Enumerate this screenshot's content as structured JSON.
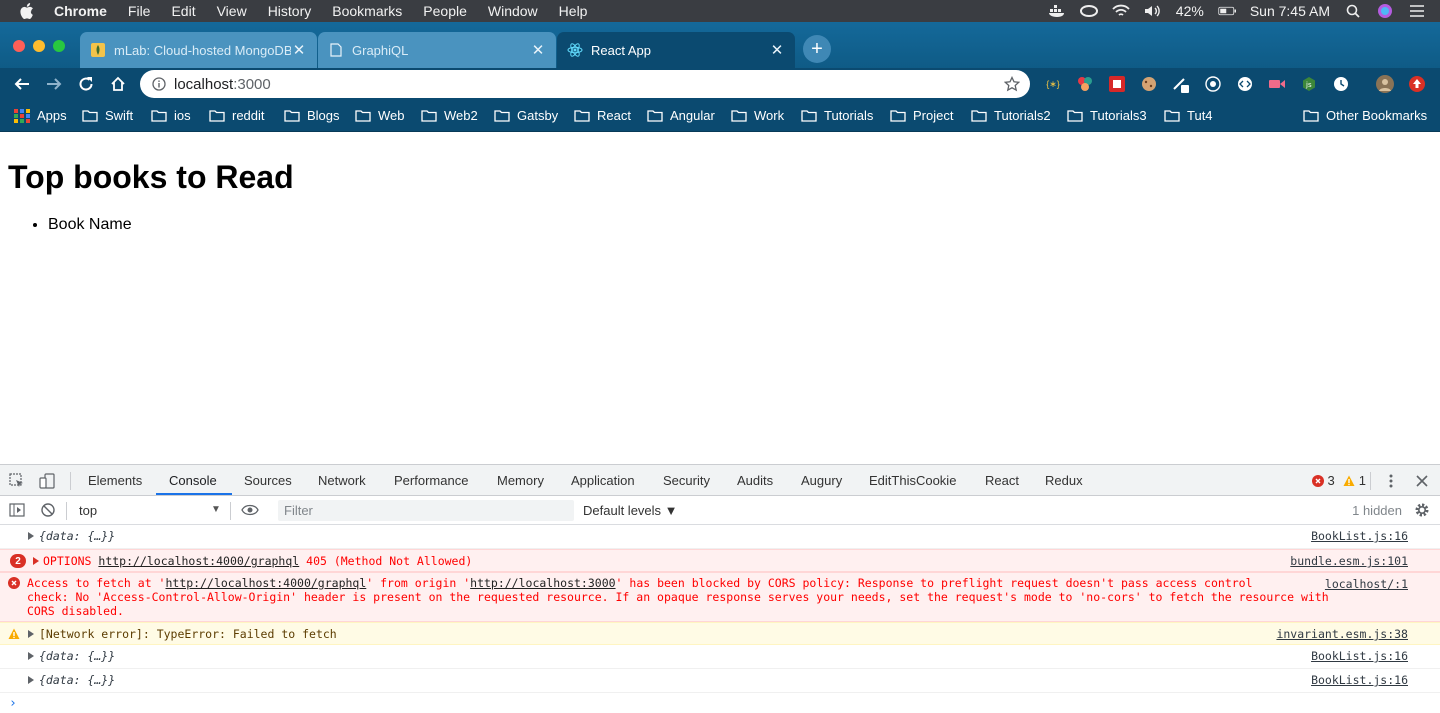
{
  "menubar": {
    "app": "Chrome",
    "items": [
      "File",
      "Edit",
      "View",
      "History",
      "Bookmarks",
      "People",
      "Window",
      "Help"
    ],
    "battery": "42%",
    "clock": "Sun 7:45 AM"
  },
  "tabs": [
    {
      "label": "mLab: Cloud-hosted MongoDB",
      "icon": "mlab-icon",
      "active": false
    },
    {
      "label": "GraphiQL",
      "icon": "page-icon",
      "active": false
    },
    {
      "label": "React App",
      "icon": "react-icon",
      "active": true
    }
  ],
  "toolbar": {
    "url_host": "localhost",
    "url_port": ":3000"
  },
  "bookmarks": {
    "apps": "Apps",
    "folders": [
      "Swift",
      "ios",
      "reddit",
      "Blogs",
      "Web",
      "Web2",
      "Gatsby",
      "React",
      "Angular",
      "Work",
      "Tutorials",
      "Project",
      "Tutorials2",
      "Tutorials3",
      "Tut4"
    ],
    "other": "Other Bookmarks"
  },
  "page": {
    "title": "Top books to Read",
    "items": [
      "Book Name"
    ]
  },
  "devtools": {
    "tabs": [
      "Elements",
      "Console",
      "Sources",
      "Network",
      "Performance",
      "Memory",
      "Application",
      "Security",
      "Audits",
      "Augury",
      "EditThisCookie",
      "React",
      "Redux"
    ],
    "active_tab": "Console",
    "error_count": "3",
    "warning_count": "1",
    "context": "top",
    "filter_placeholder": "Filter",
    "levels": "Default levels ▼",
    "hidden": "1 hidden",
    "messages": [
      {
        "type": "log",
        "text": "{data: {…}}",
        "source": "BookList.js:16"
      },
      {
        "type": "error",
        "count": "2",
        "method": "OPTIONS",
        "url": "http://localhost:4000/graphql",
        "status": "405 (Method Not Allowed)",
        "source": "bundle.esm.js:101"
      },
      {
        "type": "error",
        "text_pre": "Access to fetch at '",
        "url1": "http://localhost:4000/graphql",
        "text_mid": "' from origin '",
        "url2": "http://localhost:3000",
        "text_post": "' has been blocked by CORS policy: Response to preflight request doesn't pass access control",
        "line2": "check: No 'Access-Control-Allow-Origin' header is present on the requested resource. If an opaque response serves your needs, set the request's mode to 'no-cors' to fetch the resource with",
        "line3": "CORS disabled.",
        "source": "localhost/:1"
      },
      {
        "type": "warning",
        "text": "[Network error]: TypeError: Failed to fetch",
        "source": "invariant.esm.js:38"
      },
      {
        "type": "log",
        "text": "{data: {…}}",
        "source": "BookList.js:16"
      },
      {
        "type": "log",
        "text": "{data: {…}}",
        "source": "BookList.js:16"
      }
    ]
  }
}
